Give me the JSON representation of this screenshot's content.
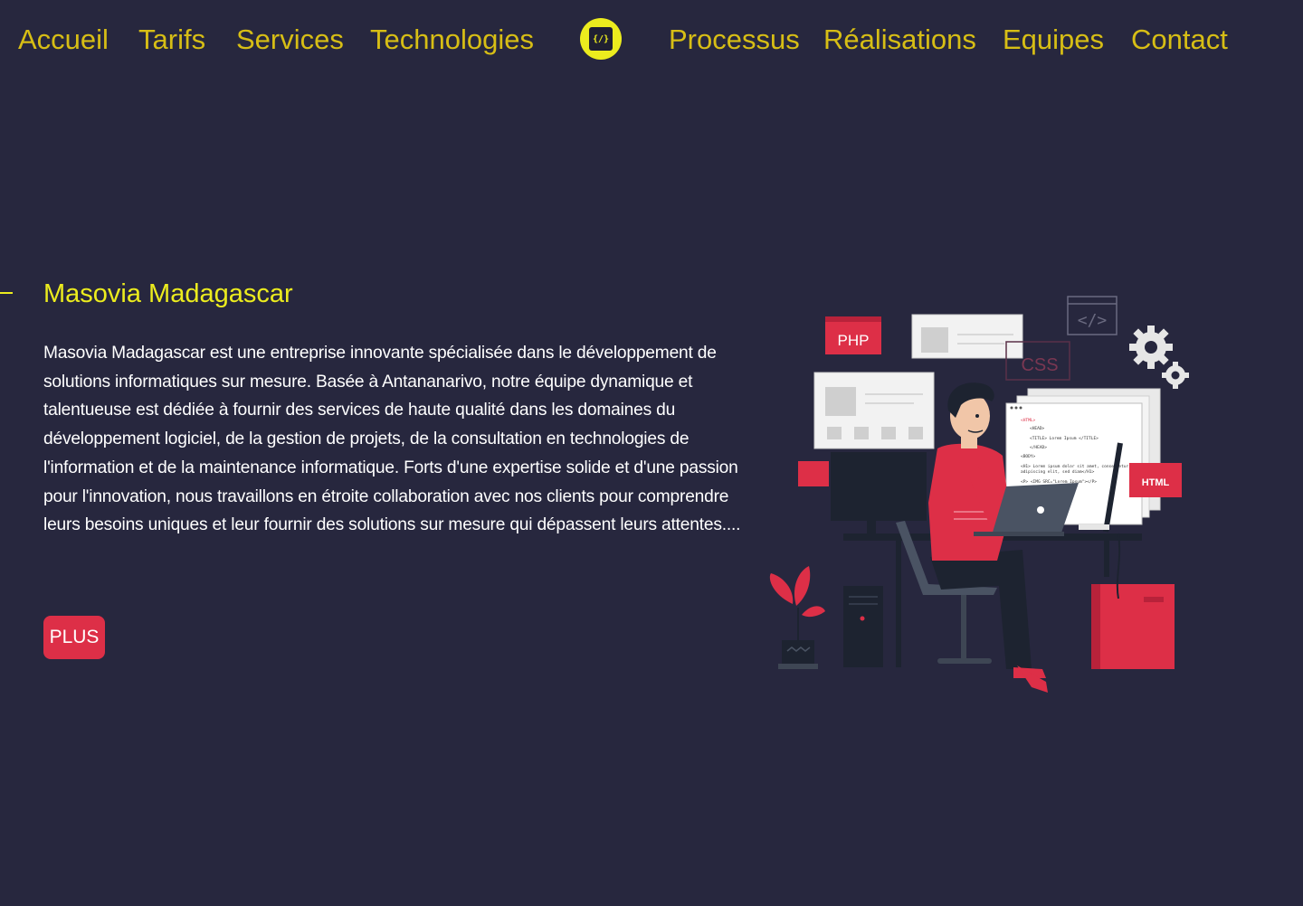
{
  "nav": {
    "left": [
      {
        "label": "Accueil"
      },
      {
        "label": "Tarifs"
      },
      {
        "label": "Services"
      },
      {
        "label": "Technologies"
      }
    ],
    "right": [
      {
        "label": "Processus"
      },
      {
        "label": "Réalisations"
      },
      {
        "label": "Equipes"
      },
      {
        "label": "Contact"
      }
    ],
    "logo_icon": "code-chip-icon",
    "logo_text": "{/}"
  },
  "hero": {
    "title": "Masovia Madagascar",
    "description": "Masovia Madagascar est une entreprise innovante spécialisée dans le développement de solutions informatiques sur mesure. Basée à Antananarivo, notre équipe dynamique et talentueuse est dédiée à fournir des services de haute qualité dans les domaines du développement logiciel, de la gestion de projets, de la consultation en technologies de l'information et de la maintenance informatique. Forts d'une expertise solide et d'une passion pour l'innovation, nous travaillons en étroite collaboration avec nos clients pour comprendre leurs besoins uniques et leur fournir des solutions sur mesure qui dépassent leurs attentes....",
    "button_label": "PLUS"
  },
  "illustration": {
    "tags": {
      "php": "PHP",
      "css": "CSS",
      "html": "HTML"
    },
    "code_symbol": "</>",
    "code_lines": [
      "<HTML>",
      "<HEAD>",
      "<TITLE> Lorem Ipsum </TITLE>",
      "</HEAD>",
      "<BODY>",
      "<H1> Lorem ipsum dolor sit amet, consectetur",
      "adipiscing elit, sed diam</H1>",
      "<P> <IMG SRC=\"Lorem Ipsum\"></P>"
    ]
  },
  "colors": {
    "background": "#27273e",
    "nav_text": "#d7be15",
    "title": "#ecec1e",
    "accent": "#dd2f47",
    "body_text": "#ffffff"
  }
}
